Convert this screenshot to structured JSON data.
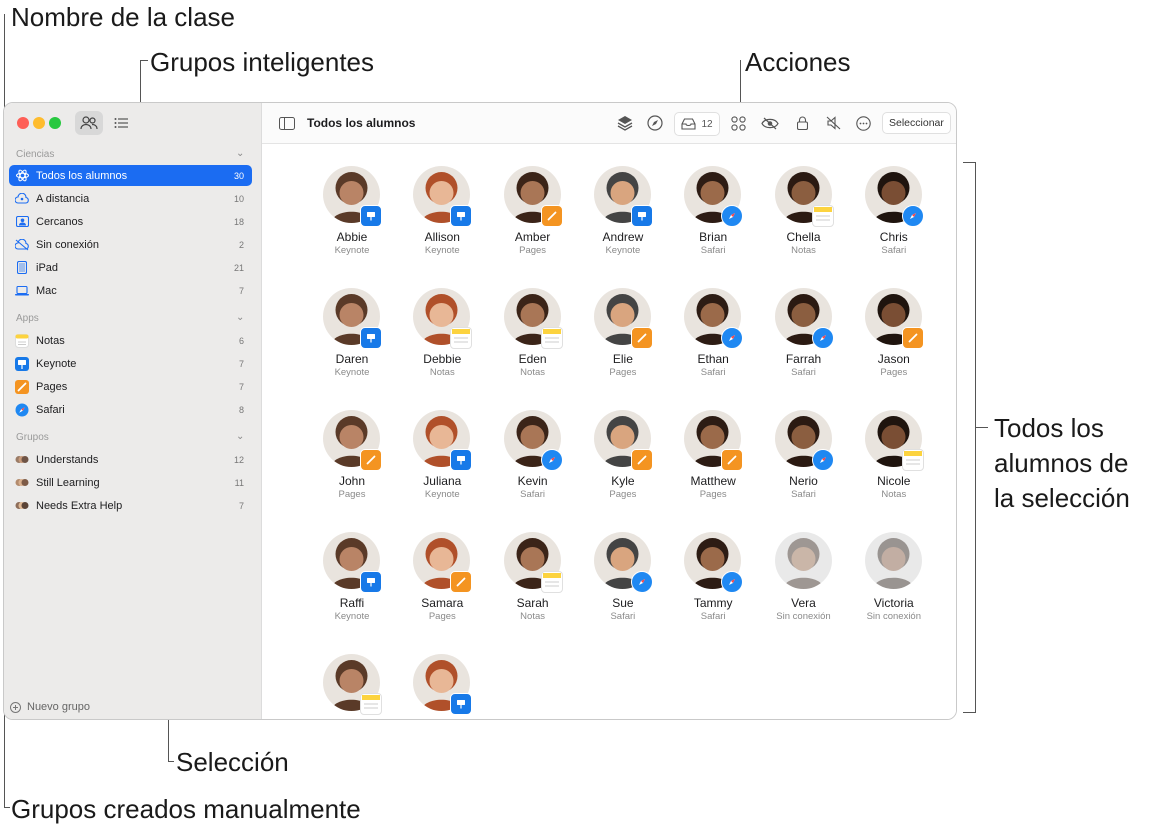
{
  "callouts": {
    "class_name": "Nombre de la clase",
    "smart_groups": "Grupos inteligentes",
    "actions": "Acciones",
    "all_students": [
      "Todos los",
      "alumnos de",
      "la selección"
    ],
    "selection": "Selección",
    "manual_groups": "Grupos creados manualmente"
  },
  "window": {
    "title": "Todos los alumnos",
    "toolbar": {
      "inbox_count": "12",
      "select_label": "Seleccionar"
    },
    "sidebar": {
      "class_name": "Ciencias",
      "smart": [
        {
          "label": "Todos los alumnos",
          "count": "30",
          "icon": "atom-icon",
          "selected": true
        },
        {
          "label": "A distancia",
          "count": "10",
          "icon": "remote-icon"
        },
        {
          "label": "Cercanos",
          "count": "18",
          "icon": "nearby-icon"
        },
        {
          "label": "Sin conexión",
          "count": "2",
          "icon": "offline-icon"
        },
        {
          "label": "iPad",
          "count": "21",
          "icon": "ipad-icon"
        },
        {
          "label": "Mac",
          "count": "7",
          "icon": "mac-icon"
        }
      ],
      "apps_header": "Apps",
      "apps": [
        {
          "label": "Notas",
          "count": "6",
          "icon": "notes-app-icon"
        },
        {
          "label": "Keynote",
          "count": "7",
          "icon": "keynote-app-icon"
        },
        {
          "label": "Pages",
          "count": "7",
          "icon": "pages-app-icon"
        },
        {
          "label": "Safari",
          "count": "8",
          "icon": "safari-app-icon"
        }
      ],
      "groups_header": "Grupos",
      "groups": [
        {
          "label": "Understands",
          "count": "12",
          "icon": "group-icon"
        },
        {
          "label": "Still Learning",
          "count": "11",
          "icon": "group-icon"
        },
        {
          "label": "Needs Extra Help",
          "count": "7",
          "icon": "group-icon"
        }
      ],
      "new_group": "Nuevo grupo"
    },
    "students": [
      {
        "name": "Abbie",
        "app": "Keynote"
      },
      {
        "name": "Allison",
        "app": "Keynote"
      },
      {
        "name": "Amber",
        "app": "Pages"
      },
      {
        "name": "Andrew",
        "app": "Keynote"
      },
      {
        "name": "Brian",
        "app": "Safari"
      },
      {
        "name": "Chella",
        "app": "Notas"
      },
      {
        "name": "Chris",
        "app": "Safari"
      },
      {
        "name": "Daren",
        "app": "Keynote"
      },
      {
        "name": "Debbie",
        "app": "Notas"
      },
      {
        "name": "Eden",
        "app": "Notas"
      },
      {
        "name": "Elie",
        "app": "Pages"
      },
      {
        "name": "Ethan",
        "app": "Safari"
      },
      {
        "name": "Farrah",
        "app": "Safari"
      },
      {
        "name": "Jason",
        "app": "Pages"
      },
      {
        "name": "John",
        "app": "Pages"
      },
      {
        "name": "Juliana",
        "app": "Keynote"
      },
      {
        "name": "Kevin",
        "app": "Safari"
      },
      {
        "name": "Kyle",
        "app": "Pages"
      },
      {
        "name": "Matthew",
        "app": "Pages"
      },
      {
        "name": "Nerio",
        "app": "Safari"
      },
      {
        "name": "Nicole",
        "app": "Notas"
      },
      {
        "name": "Raffi",
        "app": "Keynote"
      },
      {
        "name": "Samara",
        "app": "Pages"
      },
      {
        "name": "Sarah",
        "app": "Notas"
      },
      {
        "name": "Sue",
        "app": "Safari"
      },
      {
        "name": "Tammy",
        "app": "Safari"
      },
      {
        "name": "Vera",
        "app": "Sin conexión"
      },
      {
        "name": "Victoria",
        "app": "Sin conexión"
      },
      {
        "name": "",
        "app": "Notas"
      },
      {
        "name": "",
        "app": "Keynote"
      }
    ]
  },
  "colors": {
    "accent": "#1b6cf2",
    "keynote": "#1779e8",
    "pages": "#f49421",
    "safari": "#1f88f2"
  }
}
